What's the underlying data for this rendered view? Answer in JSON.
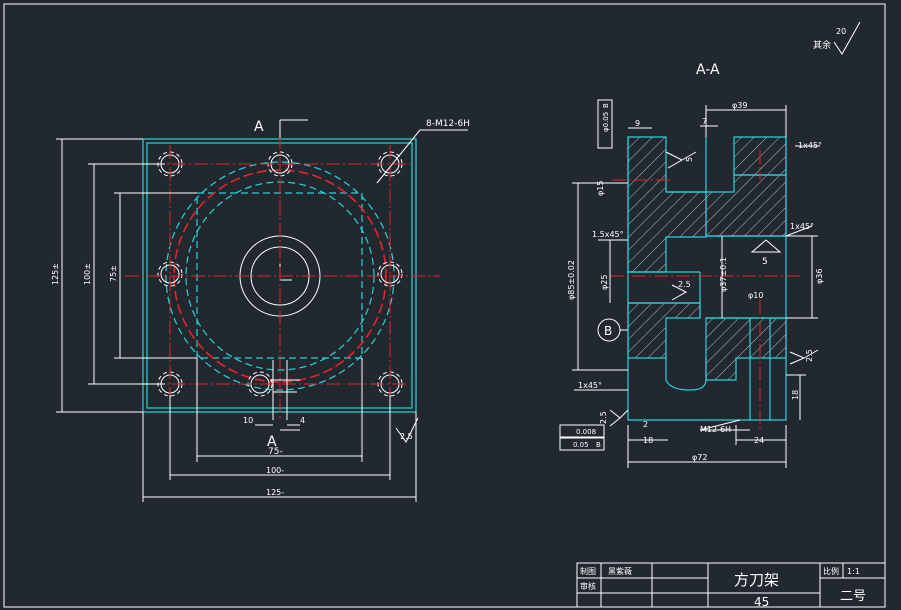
{
  "section_title": "A-A",
  "surface_finish_other": "其余",
  "surface_finish_value": "20",
  "front_view": {
    "section_mark_top": "A",
    "section_mark_bottom": "A",
    "thread_note": "8-M12-6H",
    "dims": {
      "h125": "125±",
      "h100": "100±",
      "h75": "75±",
      "w75": "75-",
      "w100": "100-",
      "w125": "125-",
      "slot_left": "10",
      "slot_right": "4",
      "roughness": "2.5"
    }
  },
  "section_view": {
    "d39": "φ39",
    "d10": "9",
    "d7": "7",
    "chamfer_top_right": "1x45°",
    "chamfer_mid_right": "1x45°",
    "chamfer_left": "1.5x45°",
    "chamfer_bottom_left": "1x45°",
    "rough_5_top": "5",
    "rough_5_mid": "5",
    "rough_25_mid": "2.5",
    "rough_25_right": "2.5",
    "rough_25_bottom": "2.5",
    "d15": "φ15",
    "d85": "φ85±0.02",
    "d25": "φ25",
    "d37": "φ37±0.1",
    "d36": "φ36",
    "d10b": "φ10",
    "h18_right": "18",
    "thread_bottom": "M12-6H",
    "w2": "2",
    "w18": "18",
    "w24": "24",
    "d72": "φ72",
    "datum": "B",
    "tol_top_val": "φ0.05",
    "tol_top_ref": "B",
    "tol_flat": "0.008",
    "tol_perp_val": "0.05",
    "tol_perp_ref": "B"
  },
  "title_block": {
    "drawn_label": "制图",
    "drawn_name": "黑紫薇",
    "checked_label": "审核",
    "part_name": "方刀架",
    "material": "45",
    "scale_label": "比例",
    "scale_value": "1:1",
    "sheet": "二号"
  }
}
